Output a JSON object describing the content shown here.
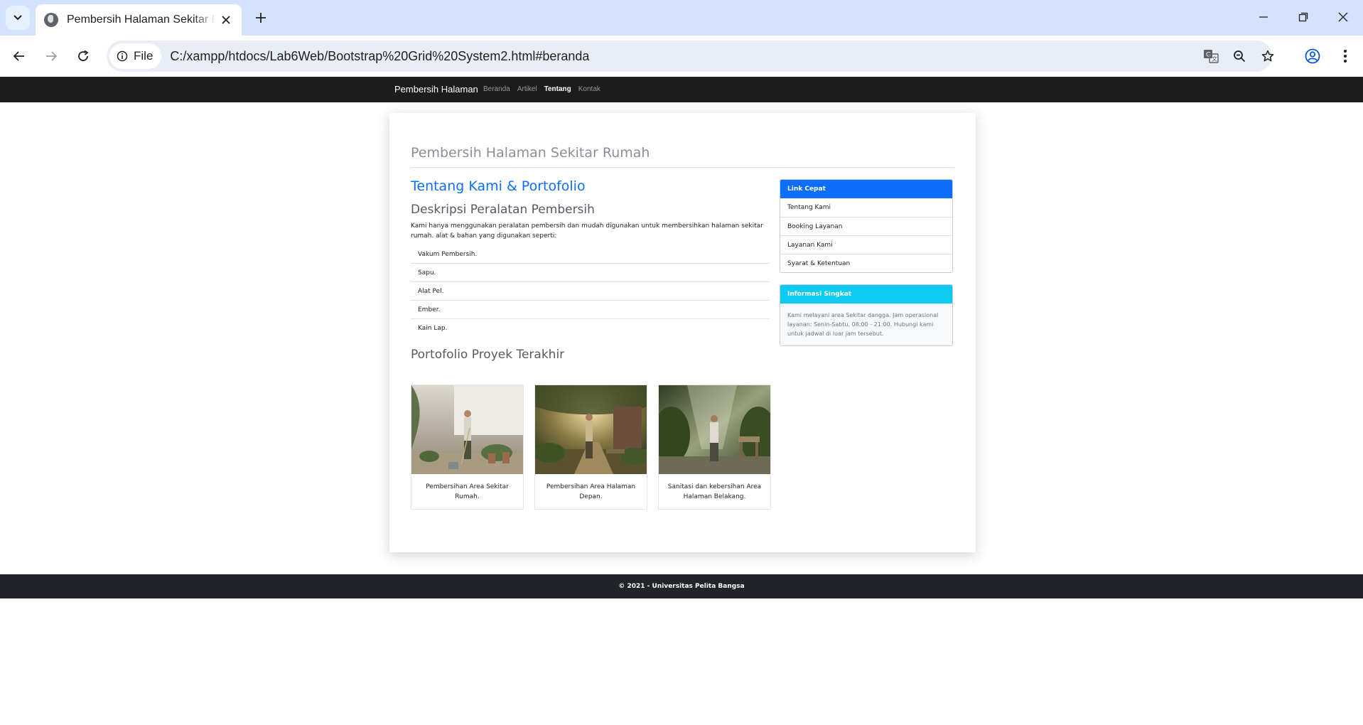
{
  "browser": {
    "tab_title": "Pembersih Halaman Sekitar Rumah",
    "site_info_label": "File",
    "url": "C:/xampp/htdocs/Lab6Web/Bootstrap%20Grid%20System2.html#beranda",
    "icons": [
      "tab-search-icon",
      "globe-icon",
      "close-icon",
      "plus-icon",
      "minimize-icon",
      "restore-icon",
      "window-close-icon",
      "back-arrow-icon",
      "forward-arrow-icon",
      "reload-icon",
      "info-icon",
      "translate-icon",
      "zoom-icon",
      "bookmark-star-icon",
      "profile-icon",
      "menu-dots-icon"
    ]
  },
  "nav": {
    "brand": "Pembersih Halaman",
    "links": [
      {
        "label": "Beranda",
        "active": false
      },
      {
        "label": "Artikel",
        "active": false
      },
      {
        "label": "Tentang",
        "active": true
      },
      {
        "label": "Kontak",
        "active": false
      }
    ]
  },
  "page": {
    "title": "Pembersih Halaman Sekitar Rumah",
    "about_heading": "Tentang Kami & Portofolio",
    "desc_heading": "Deskripsi Peralatan Pembersih",
    "desc_text": "Kami hanya menggunakan peralatan pembersih dan mudah digunakan untuk membersihkan halaman sekitar rumah. alat & bahan yang digunakan seperti:",
    "tools": [
      "Vakum Pembersih.",
      "Sapu.",
      "Alat Pel.",
      "Ember.",
      "Kain Lap."
    ],
    "portfolio_heading": "Portofolio Proyek Terakhir",
    "portfolio": [
      {
        "caption": "Pembersihan Area Sekitar Rumah."
      },
      {
        "caption": "Pembersihan Area Halaman Depan."
      },
      {
        "caption": "Sanitasi dan kebersihan Area Halaman Belakang."
      }
    ]
  },
  "sidebar": {
    "quick_links_title": "Link Cepat",
    "quick_links": [
      "Tentang Kami",
      "Booking Layanan",
      "Layanan Kami",
      "Syarat & Ketentuan"
    ],
    "info_title": "Informasi Singkat",
    "info_text": "Kami melayani area Sekitar dangga. Jam operasional layanan: Senin-Sabtu, 08:00 - 21:00. Hubungi kami untuk jadwal di luar jam tersebut."
  },
  "footer": {
    "text": "© 2021 - Universitas Pelita Bangsa"
  },
  "colors": {
    "primary": "#0d6efd",
    "info": "#0dcaf0",
    "navbar": "#1c1c1c",
    "footer": "#212529",
    "tabbar": "#d3e3fd"
  }
}
